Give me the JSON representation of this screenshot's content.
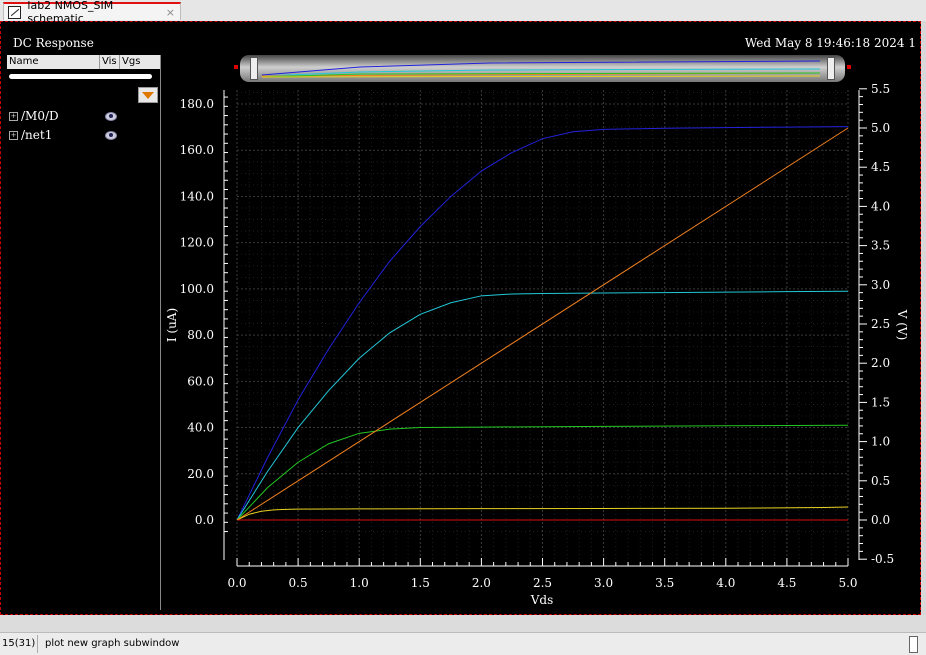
{
  "tab": {
    "title": "lab2 NMOS_SIM schematic",
    "close": "×"
  },
  "graph": {
    "title": "DC Response",
    "timestamp": "Wed May 8 19:46:18 2024  1"
  },
  "sidebar": {
    "columns": [
      "Name",
      "Vis",
      "Vgs"
    ],
    "signals": [
      {
        "name": "/M0/D"
      },
      {
        "name": "/net1"
      }
    ]
  },
  "status": {
    "count": "15(31)",
    "message": "plot new graph subwindow"
  },
  "chart_data": {
    "type": "line",
    "xlabel": "Vds",
    "ylabel": "I (uA)",
    "y2label": "V (V)",
    "xlim": [
      0,
      5
    ],
    "ylim": [
      -8,
      190
    ],
    "y2lim": [
      -0.5,
      5.5
    ],
    "xticks": [
      "0.0",
      "0.5",
      "1.0",
      "1.5",
      "2.0",
      "2.5",
      "3.0",
      "3.5",
      "4.0",
      "4.5",
      "5.0"
    ],
    "yticks": [
      "0.0",
      "20.0",
      "40.0",
      "60.0",
      "80.0",
      "100.0",
      "120.0",
      "140.0",
      "160.0",
      "180.0"
    ],
    "y2ticks": [
      "-0.5",
      "0.0",
      "0.5",
      "1.0",
      "1.5",
      "2.0",
      "2.5",
      "3.0",
      "3.5",
      "4.0",
      "4.5",
      "5.0",
      "5.5"
    ],
    "grid": true,
    "series": [
      {
        "color": "#2222dd",
        "axis": "left",
        "x": [
          0,
          0.25,
          0.5,
          0.75,
          1.0,
          1.25,
          1.5,
          1.75,
          2.0,
          2.25,
          2.5,
          2.75,
          3.0,
          3.5,
          4.0,
          4.5,
          5.0
        ],
        "y": [
          0,
          27,
          52,
          74,
          94,
          112,
          127,
          140,
          151,
          159,
          165,
          168,
          169,
          169.5,
          169.8,
          170,
          170.2
        ]
      },
      {
        "color": "#22c8d8",
        "axis": "left",
        "x": [
          0,
          0.25,
          0.5,
          0.75,
          1.0,
          1.25,
          1.5,
          1.75,
          2.0,
          2.25,
          2.5,
          3.0,
          3.5,
          4.0,
          4.5,
          5.0
        ],
        "y": [
          0,
          21,
          40,
          56,
          70,
          81,
          89,
          94,
          97,
          97.8,
          98,
          98.2,
          98.4,
          98.6,
          98.8,
          99
        ]
      },
      {
        "color": "#22c822",
        "axis": "left",
        "x": [
          0,
          0.25,
          0.5,
          0.75,
          1.0,
          1.25,
          1.5,
          2.0,
          3.0,
          4.0,
          5.0
        ],
        "y": [
          0,
          14,
          25,
          33,
          37.5,
          39.3,
          40,
          40.2,
          40.5,
          40.8,
          41
        ]
      },
      {
        "color": "#e8d020",
        "axis": "left",
        "x": [
          0,
          0.1,
          0.2,
          0.3,
          0.4,
          0.5,
          1.0,
          2.0,
          3.0,
          4.0,
          4.8,
          5.0
        ],
        "y": [
          0,
          2.5,
          3.8,
          4.4,
          4.6,
          4.7,
          4.8,
          4.9,
          5,
          5.1,
          5.4,
          5.6
        ]
      },
      {
        "color": "#dd1111",
        "axis": "left",
        "x": [
          0,
          5.0
        ],
        "y": [
          0,
          0
        ]
      },
      {
        "color": "#f08020",
        "axis": "right",
        "x": [
          0,
          5.0
        ],
        "y": [
          0,
          5.0
        ]
      }
    ]
  }
}
